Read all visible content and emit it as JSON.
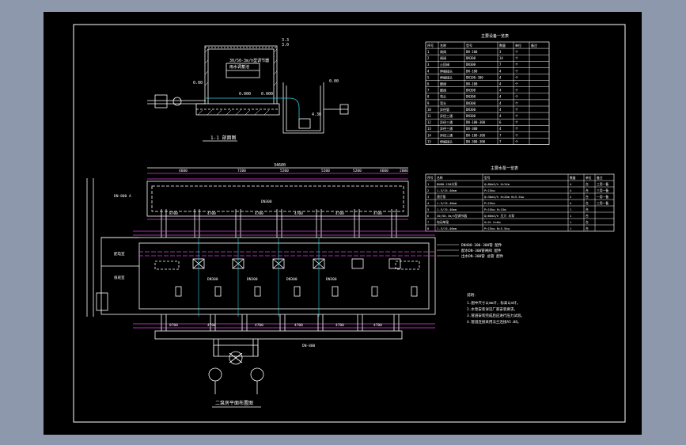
{
  "drawing": {
    "background": "#000000",
    "line_color": "#ffffff",
    "accent_pipe_color": "#e040e0",
    "accent_cyan_color": "#30d0e0"
  },
  "section_view": {
    "caption": "1-1 剖面图",
    "elev_top_1": "3.3",
    "elev_top_2": "3.0",
    "elev_left": "0.00",
    "elev_mid_1": "0.000",
    "elev_mid_2": "0.000",
    "elev_right": "0.00",
    "elev_low": "4.30",
    "box_label_1": "30/50-3m/h型调节器",
    "box_label_2": "雨水调蓄池"
  },
  "equipment_table": {
    "title": "主要设备一览表",
    "headers": [
      "序号",
      "名称",
      "型号",
      "数量",
      "单位",
      "备注"
    ],
    "rows": [
      [
        "1",
        "闸阀",
        "DN-100",
        "3",
        "个",
        ""
      ],
      [
        "2",
        "闸阀",
        "DN300",
        "14",
        "个",
        ""
      ],
      [
        "3",
        "止回阀",
        "DN300",
        "7",
        "个",
        ""
      ],
      [
        "4",
        "伸缩接头",
        "DN-100",
        "4",
        "个",
        ""
      ],
      [
        "5",
        "伸缩接头",
        "DN100-300",
        "4",
        "个",
        ""
      ],
      [
        "6",
        "蝶阀",
        "DN-100",
        "4",
        "个",
        ""
      ],
      [
        "7",
        "蝶阀",
        "DN300",
        "4",
        "个",
        ""
      ],
      [
        "8",
        "弯头",
        "DN300",
        "4",
        "个",
        ""
      ],
      [
        "9",
        "弯头",
        "DN300",
        "4",
        "个",
        ""
      ],
      [
        "10",
        "异径管",
        "DN300",
        "4",
        "个",
        ""
      ],
      [
        "11",
        "异径三通",
        "DN300",
        "4",
        "个",
        ""
      ],
      [
        "12",
        "异径三通",
        "DN-100-300",
        "6",
        "个",
        ""
      ],
      [
        "13",
        "异径三通",
        "DN-300",
        "4",
        "个",
        ""
      ],
      [
        "14",
        "异径三通",
        "DN-100-300",
        "7",
        "个",
        ""
      ],
      [
        "15",
        "伸缩接头",
        "DN-300-300",
        "7",
        "个",
        ""
      ]
    ]
  },
  "pump_table": {
    "title": "主要水泵一览表",
    "headers": [
      "序号",
      "名称",
      "型号",
      "数量",
      "单位",
      "备注"
    ],
    "rows": [
      [
        "1",
        "DN80-250水泵",
        "Q=80m3/h H=34m",
        "4",
        "台",
        "三用一备"
      ],
      [
        "2",
        "1.5/15-40mm",
        "P=15kw",
        "4",
        "台",
        "三用一备"
      ],
      [
        "3",
        "潜污泵",
        "Q=30m3/h H=20m N=5.5kw",
        "2",
        "台",
        "一用一备"
      ],
      [
        "4",
        "1.5/15-40mm",
        "P=15kw",
        "4",
        "台",
        "三用一备"
      ],
      [
        "5",
        "1.5/15-40mm",
        "P=15kw H=15m",
        "1",
        "台",
        ""
      ],
      [
        "6",
        "30/50-3m/h型调节器",
        "Q=60m3/h 压力 水泵",
        "1",
        "台",
        ""
      ],
      [
        "7",
        "电动单梁",
        "G=2t H=6m",
        "1",
        "台",
        ""
      ],
      [
        "8",
        "1.5/15-40mm",
        "P=15kw N=5.5kw",
        "1",
        "台",
        ""
      ]
    ]
  },
  "plan_view": {
    "caption": "二泵房平面布置图",
    "total_dim": "34600",
    "dims_top": [
      "4600",
      "7200",
      "5200",
      "5200",
      "5200",
      "4600",
      "2000"
    ],
    "dims_lower": [
      "8700",
      "4700",
      "4700",
      "4700",
      "4700",
      "4700"
    ],
    "pipe_label_top": "DN-800 A",
    "pipe_label_mid": "DN300",
    "pipe_label_bottom": "DN-800",
    "pump_labels": [
      "DN300",
      "DN300",
      "DN300",
      "DN300"
    ],
    "room_labels": [
      "配电室",
      "值班室"
    ],
    "callouts": [
      "DN400-300-300管 配件",
      "配水DN-300管闸阀 配件",
      "出水DN-300管 总管 配件"
    ]
  },
  "notes": {
    "title": "说明：",
    "items": [
      "1.图中尺寸以mm计，标高以m计。",
      "2.水泵安装详见厂家安装要求。",
      "3.管道安装完成后应进行压力试验。",
      "4.管道连接采用法兰连接A5.08。"
    ]
  }
}
